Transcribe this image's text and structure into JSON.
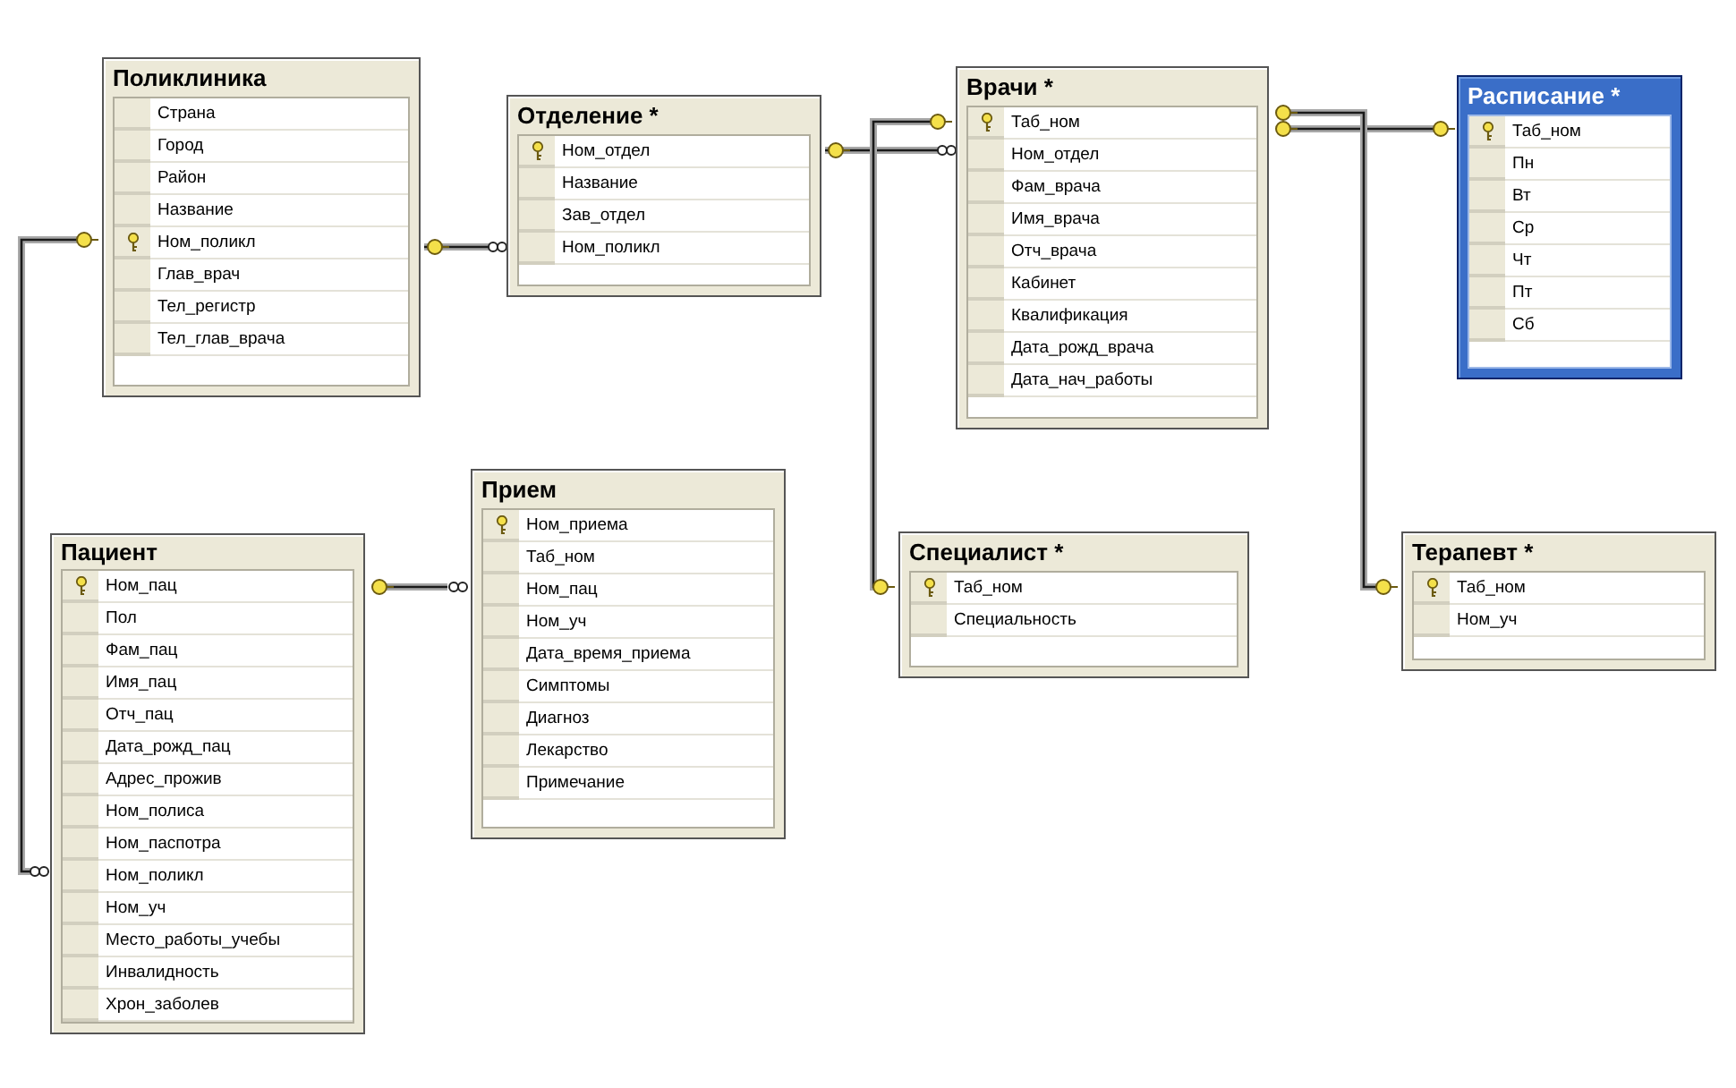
{
  "tables": [
    {
      "title": "Поликлиника",
      "selected": false,
      "columns": [
        {
          "name": "Страна",
          "primary_key": false
        },
        {
          "name": "Город",
          "primary_key": false
        },
        {
          "name": "Район",
          "primary_key": false
        },
        {
          "name": "Название",
          "primary_key": false
        },
        {
          "name": "Ном_поликл",
          "primary_key": true
        },
        {
          "name": "Глав_врач",
          "primary_key": false
        },
        {
          "name": "Тел_регистр",
          "primary_key": false
        },
        {
          "name": "Тел_глав_врача",
          "primary_key": false
        }
      ]
    },
    {
      "title": "Отделение *",
      "selected": false,
      "columns": [
        {
          "name": "Ном_отдел",
          "primary_key": true
        },
        {
          "name": "Название",
          "primary_key": false
        },
        {
          "name": "Зав_отдел",
          "primary_key": false
        },
        {
          "name": "Ном_поликл",
          "primary_key": false
        }
      ]
    },
    {
      "title": "Врачи *",
      "selected": false,
      "columns": [
        {
          "name": "Таб_ном",
          "primary_key": true
        },
        {
          "name": "Ном_отдел",
          "primary_key": false
        },
        {
          "name": "Фам_врача",
          "primary_key": false
        },
        {
          "name": "Имя_врача",
          "primary_key": false
        },
        {
          "name": "Отч_врача",
          "primary_key": false
        },
        {
          "name": "Кабинет",
          "primary_key": false
        },
        {
          "name": "Квалификация",
          "primary_key": false
        },
        {
          "name": "Дата_рожд_врача",
          "primary_key": false
        },
        {
          "name": "Дата_нач_работы",
          "primary_key": false
        }
      ]
    },
    {
      "title": "Расписание *",
      "selected": true,
      "columns": [
        {
          "name": "Таб_ном",
          "primary_key": true
        },
        {
          "name": "Пн",
          "primary_key": false
        },
        {
          "name": "Вт",
          "primary_key": false
        },
        {
          "name": "Ср",
          "primary_key": false
        },
        {
          "name": "Чт",
          "primary_key": false
        },
        {
          "name": "Пт",
          "primary_key": false
        },
        {
          "name": "Сб",
          "primary_key": false
        }
      ]
    },
    {
      "title": "Прием",
      "selected": false,
      "columns": [
        {
          "name": "Ном_приема",
          "primary_key": true
        },
        {
          "name": "Таб_ном",
          "primary_key": false
        },
        {
          "name": "Ном_пац",
          "primary_key": false
        },
        {
          "name": "Ном_уч",
          "primary_key": false
        },
        {
          "name": "Дата_время_приема",
          "primary_key": false
        },
        {
          "name": "Симптомы",
          "primary_key": false
        },
        {
          "name": "Диагноз",
          "primary_key": false
        },
        {
          "name": "Лекарство",
          "primary_key": false
        },
        {
          "name": "Примечание",
          "primary_key": false
        }
      ]
    },
    {
      "title": "Пациент",
      "selected": false,
      "columns": [
        {
          "name": "Ном_пац",
          "primary_key": true
        },
        {
          "name": "Пол",
          "primary_key": false
        },
        {
          "name": "Фам_пац",
          "primary_key": false
        },
        {
          "name": "Имя_пац",
          "primary_key": false
        },
        {
          "name": "Отч_пац",
          "primary_key": false
        },
        {
          "name": "Дата_рожд_пац",
          "primary_key": false
        },
        {
          "name": "Адрес_прожив",
          "primary_key": false
        },
        {
          "name": "Ном_полиса",
          "primary_key": false
        },
        {
          "name": "Ном_паспотра",
          "primary_key": false
        },
        {
          "name": "Ном_поликл",
          "primary_key": false
        },
        {
          "name": "Ном_уч",
          "primary_key": false
        },
        {
          "name": "Место_работы_учебы",
          "primary_key": false
        },
        {
          "name": "Инвалидность",
          "primary_key": false
        },
        {
          "name": "Хрон_заболев",
          "primary_key": false
        }
      ]
    },
    {
      "title": "Специалист *",
      "selected": false,
      "columns": [
        {
          "name": "Таб_ном",
          "primary_key": true
        },
        {
          "name": "Специальность",
          "primary_key": false
        }
      ]
    },
    {
      "title": "Терапевт *",
      "selected": false,
      "columns": [
        {
          "name": "Таб_ном",
          "primary_key": true
        },
        {
          "name": "Ном_уч",
          "primary_key": false
        }
      ]
    }
  ]
}
